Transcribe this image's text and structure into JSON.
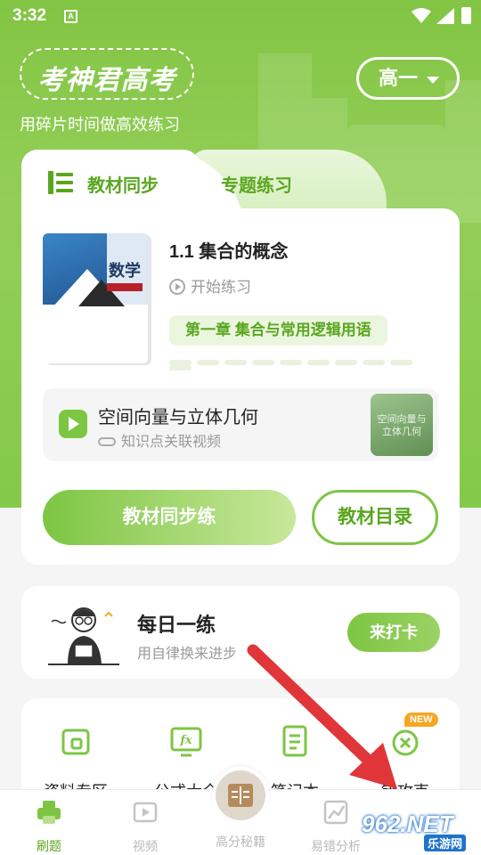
{
  "status_bar": {
    "time": "3:32",
    "app_icon_letter": "A"
  },
  "header": {
    "logo_text": "考神君高考",
    "slogan": "用碎片时间做高效练习",
    "grade_select_value": "高一"
  },
  "tabs": [
    {
      "label": "教材同步",
      "active": true
    },
    {
      "label": "专题练习",
      "active": false
    }
  ],
  "lesson": {
    "cover_title": "数学",
    "title": "1.1 集合的概念",
    "start_label": "开始练习",
    "chapter": "第一章 集合与常用逻辑用语"
  },
  "video": {
    "title": "空间向量与立体几何",
    "subtitle": "知识点关联视频",
    "thumb_text": "空间向量与立体几何"
  },
  "buttons": {
    "sync_practice": "教材同步练",
    "catalog": "教材目录"
  },
  "daily": {
    "title": "每日一练",
    "subtitle": "用自律换来进步",
    "checkin": "来打卡"
  },
  "tools": [
    {
      "label": "资料专区",
      "icon": "folder-icon"
    },
    {
      "label": "公式大全",
      "icon": "formula-icon"
    },
    {
      "label": "笔记本",
      "icon": "notebook-icon"
    },
    {
      "label": "错攻克",
      "icon": "error-fix-icon",
      "badge": "NEW"
    }
  ],
  "bottom_nav": [
    {
      "label": "刷题",
      "active": true,
      "icon": "printer-icon"
    },
    {
      "label": "视频",
      "active": false,
      "icon": "video-icon"
    },
    {
      "label": "高分秘籍",
      "active": false,
      "icon": "book-icon"
    },
    {
      "label": "易错分析",
      "active": false,
      "icon": "chart-icon"
    }
  ],
  "watermark": {
    "text": "962.NET",
    "sub": "乐游网"
  },
  "colors": {
    "primary": "#7ec543",
    "primary_dark": "#5aa61f",
    "arrow": "#e0363a"
  }
}
